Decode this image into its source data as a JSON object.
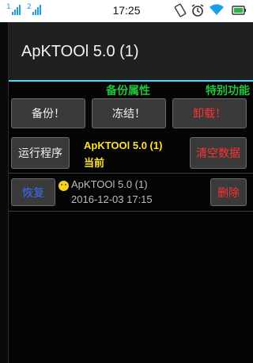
{
  "statusbar": {
    "sim1_label": "1",
    "sim2_label": "2",
    "time": "17:25",
    "icons": [
      "signal-icon",
      "signal-icon",
      "screen-rotate-icon",
      "alarm-icon",
      "wifi-icon",
      "battery-icon"
    ]
  },
  "app": {
    "title": "ApKTOOl 5.0 (1)",
    "tabs": {
      "backup_props": "备份属性",
      "special_functions": "特别功能"
    },
    "buttons": {
      "backup": "备份！",
      "freeze": "冻结！",
      "uninstall": "卸载！",
      "run": "运行程序",
      "clear_data": "清空数据",
      "restore": "恢复",
      "delete": "删除"
    },
    "current": {
      "name": "ApKTOOl 5.0 (1)",
      "status": "当前"
    },
    "backup_entry": {
      "name": "ApKTOOl 5.0 (1)",
      "date": "2016-12-03 17:15"
    }
  },
  "colors": {
    "accent_line": "#3fd8ff",
    "tab_green": "#22c43a",
    "warning_red": "#ff3030",
    "highlight_yellow": "#ffe12a",
    "restore_blue": "#3b6dff"
  }
}
